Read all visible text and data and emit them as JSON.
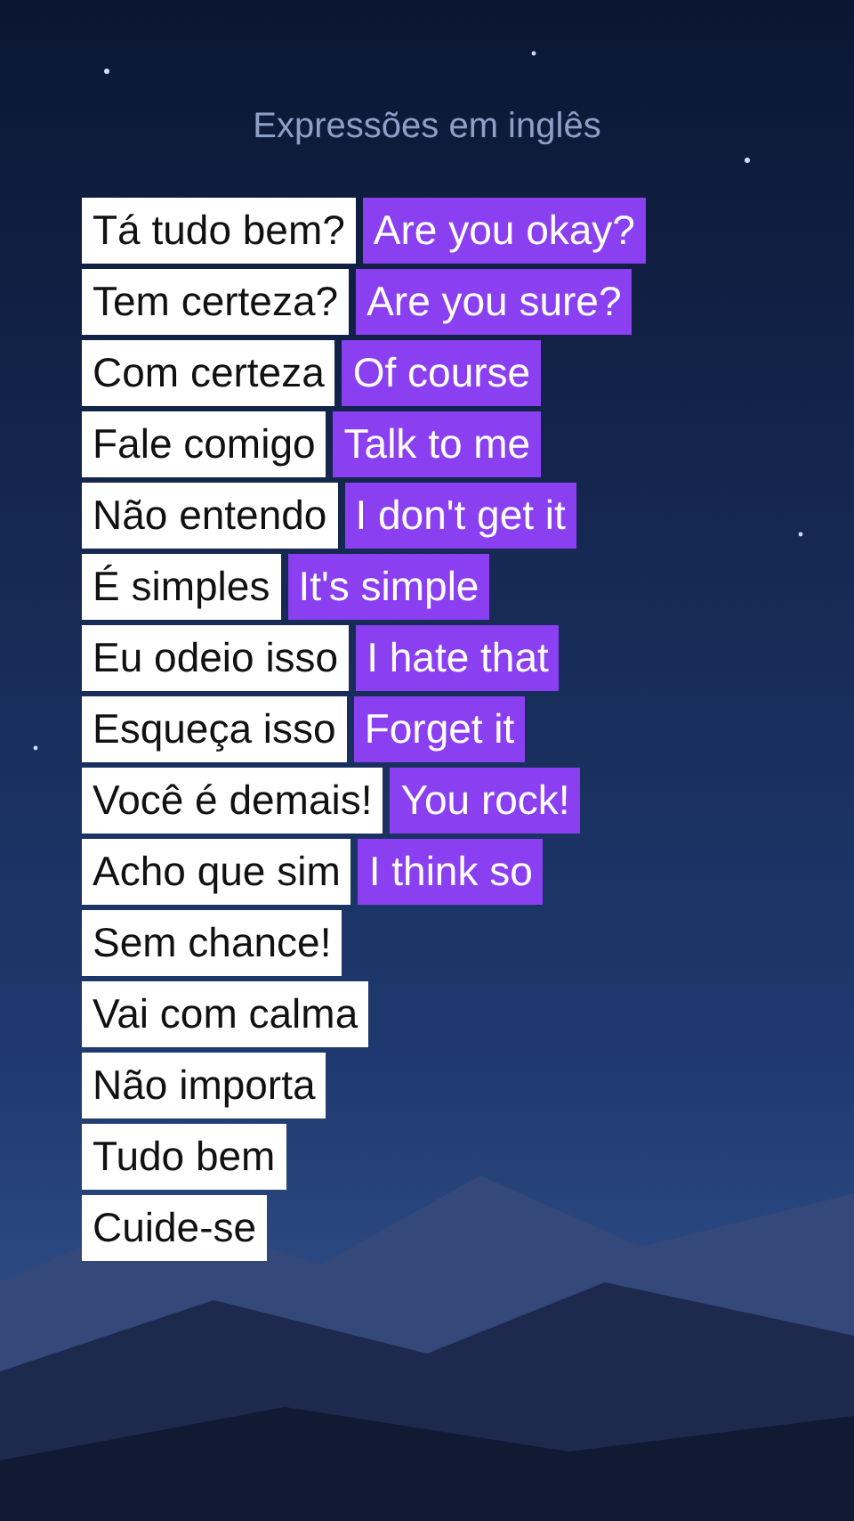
{
  "title": "Expressões em inglês",
  "phrases": [
    {
      "portuguese": "Tá tudo bem?",
      "english": "Are you okay?"
    },
    {
      "portuguese": "Tem certeza?",
      "english": "Are you sure?"
    },
    {
      "portuguese": "Com certeza",
      "english": "Of course"
    },
    {
      "portuguese": "Fale comigo",
      "english": "Talk to me"
    },
    {
      "portuguese": "Não entendo",
      "english": "I don't get it"
    },
    {
      "portuguese": "É simples",
      "english": "It's simple"
    },
    {
      "portuguese": "Eu odeio isso",
      "english": "I hate that"
    },
    {
      "portuguese": "Esqueça isso",
      "english": "Forget it"
    },
    {
      "portuguese": "Você é demais!",
      "english": "You rock!"
    },
    {
      "portuguese": "Acho que sim",
      "english": "I think so"
    },
    {
      "portuguese": "Sem chance!"
    },
    {
      "portuguese": "Vai com calma"
    },
    {
      "portuguese": "Não importa"
    },
    {
      "portuguese": "Tudo bem"
    },
    {
      "portuguese": "Cuide-se"
    }
  ]
}
